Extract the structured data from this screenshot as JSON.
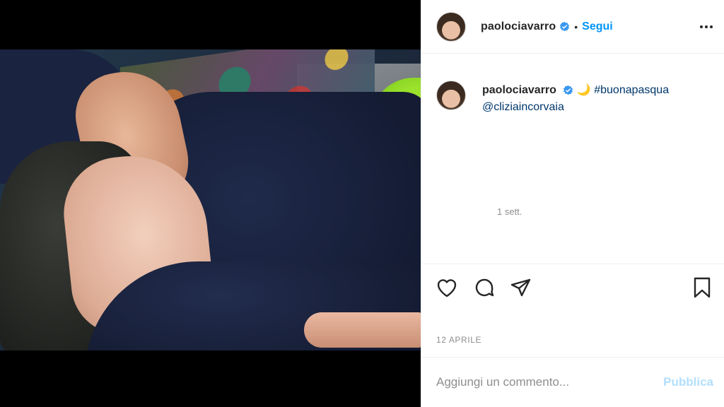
{
  "post": {
    "username": "paolociavarro",
    "verified_icon": "verified-badge-icon",
    "separator": "•",
    "follow_label": "Segui",
    "more_icon": "more-options-icon"
  },
  "caption": {
    "username": "paolociavarro",
    "emoji": "🌙",
    "hashtag": "#buonapasqua",
    "mention": "@cliziaincorvaia",
    "time_ago": "1 sett."
  },
  "actions": {
    "like_icon": "heart-icon",
    "comment_icon": "comment-icon",
    "share_icon": "share-icon",
    "save_icon": "bookmark-icon"
  },
  "date_label": "12 APRILE",
  "comment_box": {
    "placeholder": "Aggiungi un commento...",
    "publish_label": "Pubblica"
  },
  "colors": {
    "link_blue": "#0095f6",
    "hashtag_blue": "#00376b",
    "muted_gray": "#8e8e8e",
    "publish_disabled": "#b2dffc"
  }
}
